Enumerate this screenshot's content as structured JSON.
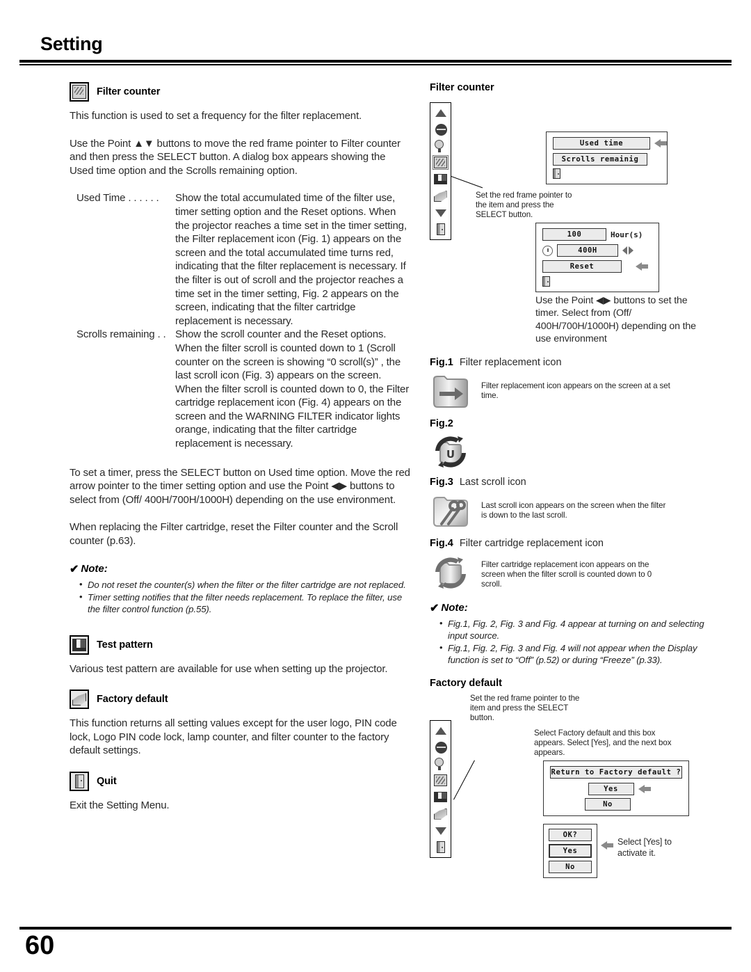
{
  "header": {
    "title": "Setting"
  },
  "footer": {
    "page_number": "60"
  },
  "left_column": {
    "filter_counter": {
      "icon": "filter-counter-icon",
      "heading": "Filter counter",
      "intro": "This function is used to set a frequency for the filter replacement.",
      "usage": "Use the Point ▲▼ buttons to move the red frame pointer to Filter counter and then press the SELECT button. A dialog box appears showing the Used time option and the Scrolls remaining option.",
      "definitions": [
        {
          "term": "Used Time  . . . . . .",
          "description": "Show the total accumulated time of the filter use, timer setting option and the Reset options. When the projector reaches a time set in the timer setting, the Filter replacement icon (Fig. 1) appears on the screen and the total accumulated time turns red, indicating that the filter replacement is necessary. If the filter is out of scroll and the projector reaches a time set in the timer setting, Fig. 2 appears on the screen, indicating that the filter cartridge replacement is necessary."
        },
        {
          "term": "Scrolls remaining . .",
          "description": "Show the scroll counter and the Reset options. When the filter scroll is counted down to 1 (Scroll counter on the screen is showing “0 scroll(s)” , the last scroll icon (Fig. 3) appears on the screen. When the filter scroll is counted down to 0, the Filter cartridge replacement icon (Fig. 4) appears on the screen and the WARNING FILTER indicator lights orange, indicating that the filter cartridge replacement is necessary."
        }
      ],
      "timer_para": "To set a timer, press the SELECT button on Used time option. Move the red arrow pointer to the timer setting option and use the Point ◀▶ buttons to select from (Off/ 400H/700H/1000H) depending on the use environment.",
      "reset_para": "When replacing the Filter cartridge, reset the Filter counter and the Scroll counter (p.63).",
      "note": {
        "title": "Note:",
        "items": [
          "Do not reset the counter(s) when the filter or the filter cartridge are not replaced.",
          "Timer setting notifies that the filter needs replacement. To replace the filter, use the filter control function (p.55)."
        ]
      }
    },
    "test_pattern": {
      "icon": "test-pattern-icon",
      "heading": "Test pattern",
      "body": "Various test pattern are available for use when setting up the projector."
    },
    "factory_default": {
      "icon": "factory-default-icon",
      "heading": "Factory default",
      "body": "This function returns all setting values except for the user logo, PIN code lock, Logo PIN code lock, lamp counter, and filter counter to the factory default settings."
    },
    "quit": {
      "icon": "quit-icon",
      "heading": "Quit",
      "body": "Exit the Setting Menu."
    }
  },
  "right_column": {
    "filter_counter_panel": {
      "heading": "Filter counter",
      "menu_items": [
        "up-arrow-icon",
        "screen-icon",
        "lamp-control-icon",
        "filter-counter-icon",
        "test-pattern-icon",
        "factory-default-icon",
        "down-arrow-icon",
        "quit-icon"
      ],
      "callout": "Set the red frame pointer to the item and press the SELECT button.",
      "dialog1": {
        "rows": [
          "Used time",
          "Scrolls remainig"
        ],
        "quit_icon": "quit-icon",
        "pointer": "left-arrow-pointer"
      },
      "dialog2": {
        "used_time_value": "100",
        "hours_label": "Hour(s)",
        "timer_value": "400H",
        "reset_label": "Reset",
        "clock_icon": "clock-icon",
        "lr_icon": "left-right-arrows-icon",
        "quit_icon": "quit-icon",
        "pointer": "left-arrow-pointer"
      },
      "timer_text": "Use the Point ◀▶ buttons to set the timer. Select from (Off/ 400H/700H/1000H) depending on the use environment"
    },
    "figures": [
      {
        "label": "Fig.1",
        "title": "Filter replacement icon",
        "icon": "filter-replacement-icon",
        "caption": "Filter replacement icon appears on the screen at a set time."
      },
      {
        "label": "Fig.2",
        "title": "",
        "icon": "filter-cartridge-u-icon",
        "caption": ""
      },
      {
        "label": "Fig.3",
        "title": "Last scroll icon",
        "icon": "last-scroll-icon",
        "caption": "Last scroll icon appears on the screen when the filter is down to the last scroll."
      },
      {
        "label": "Fig.4",
        "title": "Filter cartridge replacement icon",
        "icon": "filter-cartridge-replacement-icon",
        "caption": "Filter cartridge replacement icon appears on the screen when the filter scroll is counted down to 0 scroll."
      }
    ],
    "note": {
      "title": "Note:",
      "items": [
        "Fig.1, Fig. 2, Fig. 3 and Fig. 4 appear at turning on and selecting input source.",
        "Fig.1, Fig. 2, Fig. 3 and Fig. 4 will not appear when the Display function is set to “Off” (p.52) or during “Freeze” (p.33)."
      ]
    },
    "factory_default_panel": {
      "heading": "Factory default",
      "callout": "Set the red frame pointer to the item and press the SELECT button.",
      "menu_items": [
        "up-arrow-icon",
        "screen-icon",
        "lamp-control-icon",
        "filter-counter-icon",
        "test-pattern-icon",
        "factory-default-icon",
        "down-arrow-icon",
        "quit-icon"
      ],
      "explain": "Select Factory default and this box appears. Select [Yes], and the next box appears.",
      "dialog1": {
        "question": "Return to Factory default ?",
        "yes_label": "Yes",
        "no_label": "No",
        "pointer": "left-arrow-pointer"
      },
      "dialog2": {
        "question": "OK?",
        "yes_label": "Yes",
        "no_label": "No",
        "pointer": "left-arrow-pointer"
      },
      "activate_text": "Select [Yes] to activate it."
    }
  }
}
